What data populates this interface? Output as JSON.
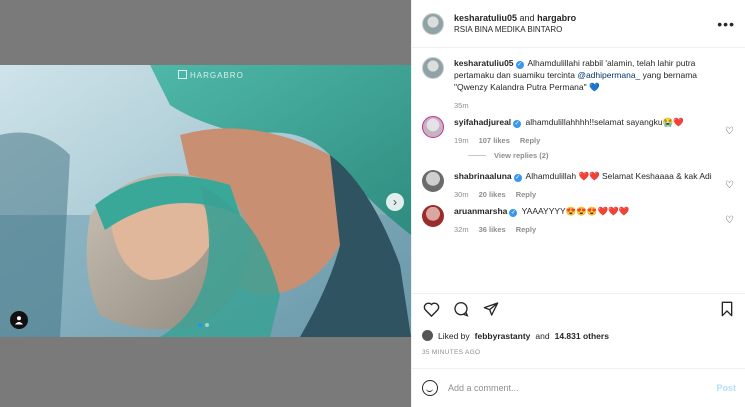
{
  "post": {
    "header": {
      "user1": "kesharatuliu05",
      "joiner": "and",
      "user2": "hargabro",
      "location": "RSIA BINA MEDIKA BINTARO"
    },
    "photo": {
      "watermark": "HARGABRO"
    },
    "caption": {
      "user": "kesharatuliu05",
      "text_before_mention": "Alhamdulillahi rabbil 'alamin, telah lahir putra pertamaku dan suamiku tercinta ",
      "mention": "@adhipermana_",
      "text_after_mention": " yang bernama \"Qwenzy Kalandra Putra Permana\" 💙",
      "time": "35m"
    },
    "comments": [
      {
        "user": "syifahadjureal",
        "text": "alhamdulillahhhh!!selamat sayangku😭❤️",
        "time": "19m",
        "likes": "107 likes",
        "reply": "Reply",
        "view_replies": "View replies (2)"
      },
      {
        "user": "shabrinaaluna",
        "text": "Alhamdulillah ❤️❤️ Selamat Keshaaaa & kak Adi",
        "time": "30m",
        "likes": "20 likes",
        "reply": "Reply"
      },
      {
        "user": "aruanmarsha",
        "text": "YAAAYYYY😍😍😍❤️❤️❤️",
        "time": "32m",
        "likes": "36 likes",
        "reply": "Reply"
      }
    ],
    "likes": {
      "prefix": "Liked by",
      "user": "febbyrastanty",
      "joiner": "and",
      "count": "14.831 others"
    },
    "timeago": "35 MINUTES AGO",
    "add_comment": {
      "placeholder": "Add a comment...",
      "post_label": "Post"
    }
  },
  "icons": [
    "more-icon",
    "heart-icon",
    "comment-icon",
    "share-icon",
    "bookmark-icon",
    "emoji-icon",
    "next-arrow-icon",
    "tag-icon"
  ],
  "colors": {
    "link": "#00376b",
    "verified": "#3897f0",
    "post_disabled": "#b2dffc",
    "meta": "#8e8e8e"
  }
}
